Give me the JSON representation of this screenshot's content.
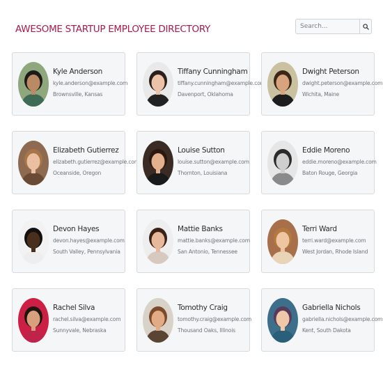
{
  "header": {
    "title": "AWESOME STARTUP EMPLOYEE DIRECTORY",
    "search_placeholder": "Search...",
    "search_icon": "search-icon"
  },
  "employees": [
    {
      "name": "Kyle Anderson",
      "email": "kyle.anderson@example.com",
      "location": "Brownsville, Kansas",
      "skin": "#b98a63",
      "hair": "#1e1a17",
      "shirt": "#3f6b55",
      "bg": "#8fa77c"
    },
    {
      "name": "Tiffany Cunningham",
      "email": "tiffany.cunningham@example.com",
      "location": "Davenport, Oklahoma",
      "skin": "#ecc3a9",
      "hair": "#2a1f1a",
      "shirt": "#222222",
      "bg": "#e9e9e9"
    },
    {
      "name": "Dwight Peterson",
      "email": "dwight.peterson@example.com",
      "location": "Wichita, Maine",
      "skin": "#d8a47e",
      "hair": "#3b2618",
      "shirt": "#1d1d1d",
      "bg": "#c9c1a0"
    },
    {
      "name": "Elizabeth Gutierrez",
      "email": "elizabeth.gutierrez@example.com",
      "location": "Oceanside, Oregon",
      "skin": "#eac0a0",
      "hair": "#a9744a",
      "shirt": "#6b4a35",
      "bg": "#8d6a50"
    },
    {
      "name": "Louise Sutton",
      "email": "louise.sutton@example.com",
      "location": "Thornton, Louisiana",
      "skin": "#e2b08f",
      "hair": "#2a1810",
      "shirt": "#1a1a1a",
      "bg": "#3a2c24"
    },
    {
      "name": "Eddie Moreno",
      "email": "eddie.moreno@example.com",
      "location": "Baton Rouge, Georgia",
      "skin": "#cfcfcf",
      "hair": "#2b2b2b",
      "shirt": "#8a8a8a",
      "bg": "#e6e6e6"
    },
    {
      "name": "Devon Hayes",
      "email": "devon.hayes@example.com",
      "location": "South Valley, Pennsylvania",
      "skin": "#4a2e1e",
      "hair": "#141010",
      "shirt": "#eeeeee",
      "bg": "#f2f2f2"
    },
    {
      "name": "Mattie Banks",
      "email": "mattie.banks@example.com",
      "location": "San Antonio, Tennessee",
      "skin": "#e8b89a",
      "hair": "#3a2218",
      "shirt": "#d8c9c0",
      "bg": "#eeeeee"
    },
    {
      "name": "Terri Ward",
      "email": "terri.ward@example.com",
      "location": "West Jordan, Rhode Island",
      "skin": "#f0c6a2",
      "hair": "#b5793f",
      "shirt": "#e9d4b8",
      "bg": "#a8704a"
    },
    {
      "name": "Rachel Silva",
      "email": "rachel.silva@example.com",
      "location": "Sunnyvale, Nebraska",
      "skin": "#d9a07e",
      "hair": "#1e1410",
      "shirt": "#c0234a",
      "bg": "#cc1f44"
    },
    {
      "name": "Tomothy Craig",
      "email": "tomothy.craig@example.com",
      "location": "Thousand Oaks, Illinois",
      "skin": "#e2aa85",
      "hair": "#7a4a2a",
      "shirt": "#5a4535",
      "bg": "#d8d2c8"
    },
    {
      "name": "Gabriella Nichols",
      "email": "gabriella.nichols@example.com",
      "location": "Kent, South Dakota",
      "skin": "#f0c8a8",
      "hair": "#5a3a5a",
      "shirt": "#2a5f7a",
      "bg": "#3e6f8a"
    }
  ]
}
